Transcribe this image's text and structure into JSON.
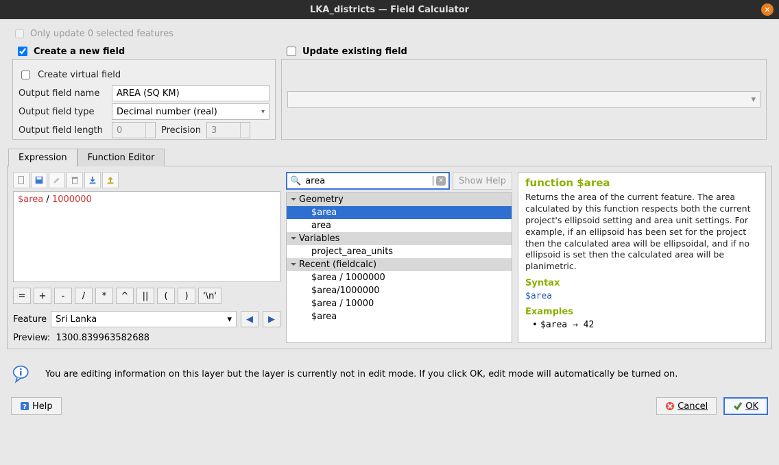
{
  "window": {
    "title": "LKA_districts — Field Calculator"
  },
  "top": {
    "only_update_label": "Only update 0 selected features",
    "create_new_label": "Create a new field",
    "update_existing_label": "Update existing field",
    "create_new_checked": true,
    "update_existing_checked": false
  },
  "new_field": {
    "virtual_label": "Create virtual field",
    "name_label": "Output field name",
    "name_value": "AREA (SQ KM)",
    "type_label": "Output field type",
    "type_value": "Decimal number (real)",
    "length_label": "Output field length",
    "length_value": "0",
    "precision_label": "Precision",
    "precision_value": "3"
  },
  "tabs": {
    "expression": "Expression",
    "function_editor": "Function Editor"
  },
  "expression": {
    "code_var": "$area",
    "code_op": " / ",
    "code_num": "1000000",
    "ops": [
      "=",
      "+",
      "-",
      "/",
      "*",
      "^",
      "||",
      "(",
      ")",
      "'\\n'"
    ],
    "feature_label": "Feature",
    "feature_value": "Sri Lanka",
    "preview_label": "Preview:",
    "preview_value": "1300.839963582688"
  },
  "search": {
    "value": "area",
    "show_help": "Show Help"
  },
  "tree": {
    "groups": [
      {
        "label": "Geometry",
        "items": [
          "$area",
          "area"
        ],
        "selected": 0
      },
      {
        "label": "Variables",
        "items": [
          "project_area_units"
        ]
      },
      {
        "label": "Recent (fieldcalc)",
        "items": [
          "$area / 1000000",
          "$area/1000000",
          "$area / 10000",
          "$area"
        ]
      }
    ]
  },
  "help_panel": {
    "title": "function $area",
    "desc": "Returns the area of the current feature. The area calculated by this function respects both the current project's ellipsoid setting and area unit settings. For example, if an ellipsoid has been set for the project then the calculated area will be ellipsoidal, and if no ellipsoid is set then the calculated area will be planimetric.",
    "syntax_label": "Syntax",
    "syntax": "$area",
    "examples_label": "Examples",
    "example": "$area → 42"
  },
  "info": "You are editing information on this layer but the layer is currently not in edit mode. If you click OK, edit mode will automatically be turned on.",
  "buttons": {
    "help": "Help",
    "cancel": "Cancel",
    "ok": "OK"
  }
}
